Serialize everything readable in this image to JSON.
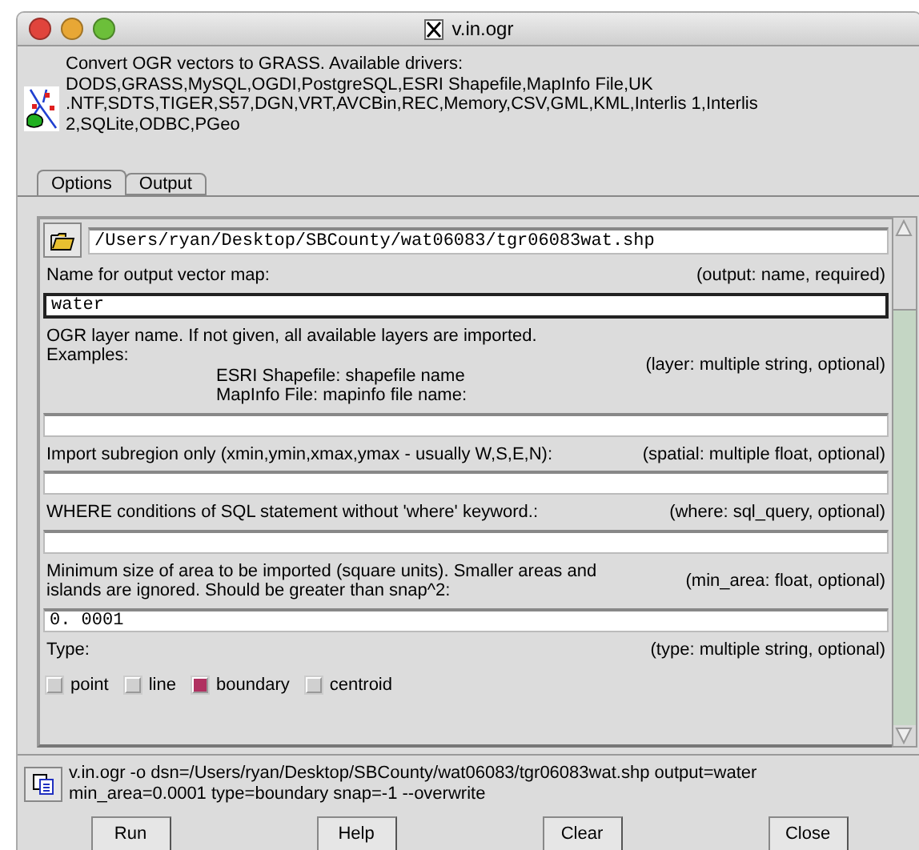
{
  "window": {
    "title": "v.in.ogr"
  },
  "description_lines": [
    "Convert OGR vectors to GRASS. Available drivers:",
    "DODS,GRASS,MySQL,OGDI,PostgreSQL,ESRI Shapefile,MapInfo File,UK",
    ".NTF,SDTS,TIGER,S57,DGN,VRT,AVCBin,REC,Memory,CSV,GML,KML,Interlis 1,Interlis",
    "2,SQLite,ODBC,PGeo"
  ],
  "tabs": [
    {
      "label": "Options",
      "selected": true
    },
    {
      "label": "Output",
      "selected": false
    }
  ],
  "file_input": {
    "value": "/Users/ryan/Desktop/SBCounty/wat06083/tgr06083wat.shp"
  },
  "options": [
    {
      "kind": "text",
      "label_lines": [
        "Name for output vector map:"
      ],
      "spec": "(output:  name, required)",
      "value": "water",
      "focused": true
    },
    {
      "kind": "text",
      "label_lines": [
        "OGR layer name. If not given, all available layers are imported.",
        "Examples:"
      ],
      "example_lines": [
        "ESRI Shapefile: shapefile name",
        "MapInfo File: mapinfo file name:"
      ],
      "spec": "(layer: multiple string, optional)",
      "focused": false
    },
    {
      "kind": "text",
      "label_lines": [
        "Import subregion only (xmin,ymin,xmax,ymax  - usually W,S,E,N):"
      ],
      "spec": "(spatial: multiple float, optional)",
      "focused": false
    },
    {
      "kind": "text",
      "label_lines": [
        "WHERE conditions of SQL statement without 'where' keyword.:"
      ],
      "spec": "(where:  sql_query, optional)",
      "focused": false
    },
    {
      "kind": "text",
      "label_lines": [
        "Minimum size of area to be imported (square units). Smaller areas and",
        "islands are ignored. Should be greater than snap^2:"
      ],
      "spec": "(min_area:  float, optional)",
      "value": "0. 0001",
      "focused": false
    },
    {
      "kind": "checks",
      "label_lines": [
        "Type:"
      ],
      "spec": "(type: multiple string, optional)",
      "choices": [
        {
          "label": "point",
          "checked": false
        },
        {
          "label": "line",
          "checked": false
        },
        {
          "label": "boundary",
          "checked": true
        },
        {
          "label": "centroid",
          "checked": false
        }
      ]
    }
  ],
  "command_lines": [
    "v.in.ogr -o dsn=/Users/ryan/Desktop/SBCounty/wat06083/tgr06083wat.shp output=water",
    "min_area=0.0001 type=boundary snap=-1 --overwrite"
  ],
  "buttons": [
    "Run",
    "Help",
    "Clear",
    "Close"
  ]
}
